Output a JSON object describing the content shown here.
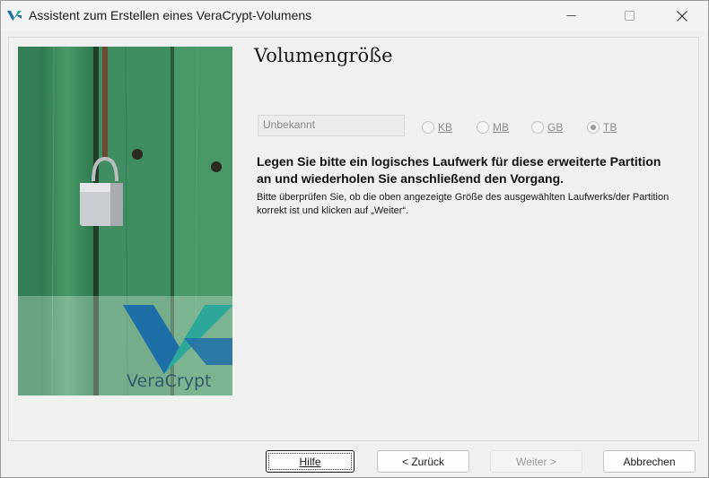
{
  "window": {
    "title": "Assistent zum Erstellen eines VeraCrypt-Volumens"
  },
  "page": {
    "title": "Volumengröße",
    "size_value": "Unbekannt",
    "units": [
      {
        "label": "KB",
        "checked": false
      },
      {
        "label": "MB",
        "checked": false
      },
      {
        "label": "GB",
        "checked": false
      },
      {
        "label": "TB",
        "checked": true
      }
    ],
    "message_bold": "Legen Sie bitte ein logisches Laufwerk für diese erweiterte Partition an und wiederholen Sie anschließend den Vorgang.",
    "message_small": "Bitte überprüfen Sie, ob die oben angezeigte Größe des ausgewählten Laufwerks/der Partition korrekt ist und klicken auf „Weiter“."
  },
  "sidebar": {
    "logo_text": "VeraCrypt"
  },
  "buttons": {
    "help": "Hilfe",
    "back": "< Zurück",
    "next": "Weiter >",
    "cancel": "Abbrechen"
  },
  "colors": {
    "logo_blue": "#1e6fa8",
    "logo_teal": "#2ea79b",
    "door_green": "#3e8a5e"
  }
}
